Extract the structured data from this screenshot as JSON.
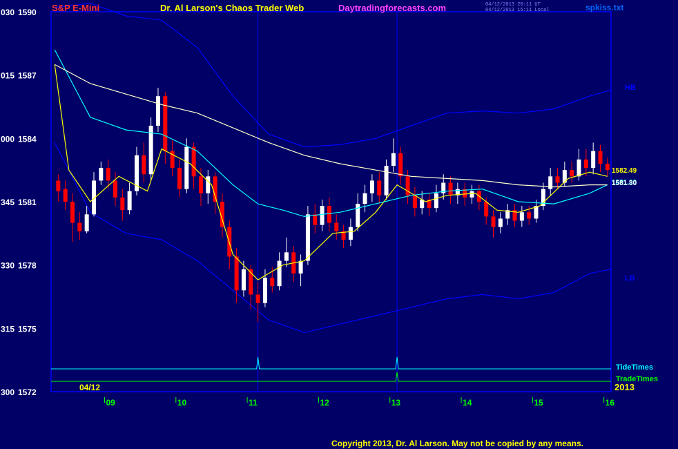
{
  "header": {
    "instrument": "S&P E-Mini",
    "title": "Dr. Al Larson's Chaos Trader Web",
    "site": "Daytradingforecasts.com",
    "stamp_utc": "04/12/2013 20:11 UT",
    "stamp_local": "04/12/2013 15:11 Local",
    "file": "spkiss.txt"
  },
  "footer": {
    "copyright": "Copyright 2013, Dr. Al Larson. May not be copied by any means."
  },
  "colors": {
    "background": "#000066",
    "frame": "#0000ff",
    "up_candle": "#ffffff",
    "down_candle": "#ff0000",
    "ema_fast": "#ffff00",
    "ema_mid": "#00ffff",
    "ema_slow": "#ffffcc",
    "bands": "#0000ff",
    "tide_times": "#00ffff",
    "trade_times": "#00ff00"
  },
  "chart_data": {
    "type": "line",
    "title": "S&P E-Mini",
    "y_left_labels": [
      {
        "code": "030",
        "price": "1590"
      },
      {
        "code": "015",
        "price": "1587"
      },
      {
        "code": "000",
        "price": "1584"
      },
      {
        "code": "345",
        "price": "1581"
      },
      {
        "code": "330",
        "price": "1578"
      },
      {
        "code": "315",
        "price": "1575"
      },
      {
        "code": "300",
        "price": "1572"
      }
    ],
    "ylim": [
      1572,
      1590
    ],
    "x_hour_labels": [
      "09",
      "10",
      "11",
      "12",
      "13",
      "14",
      "15",
      "16"
    ],
    "date_label": "04/12",
    "year_label": "2013",
    "band_labels": {
      "upper": "HB",
      "lower": "LB"
    },
    "price_tags": {
      "fast": "1582.49",
      "mid": "1581.90",
      "slow": "1581.80"
    },
    "timing_rows": [
      {
        "name": "TideTimes",
        "spikes_at_hour": [
          11.15,
          13.1
        ]
      },
      {
        "name": "TradeTimes",
        "spikes_at_hour": [
          13.1
        ]
      }
    ],
    "vertical_time_lines": [
      11.15,
      13.1
    ],
    "series": [
      {
        "name": "ema_fast",
        "x": [
          8.3,
          8.5,
          8.8,
          9.2,
          9.6,
          9.8,
          10.2,
          10.5,
          10.8,
          11.15,
          11.5,
          11.8,
          12.2,
          12.5,
          12.8,
          13.1,
          13.5,
          13.8,
          14.2,
          14.5,
          14.8,
          15.1,
          15.5,
          15.8,
          16.05
        ],
        "y": [
          1587.5,
          1582.5,
          1581.0,
          1582.2,
          1581.5,
          1583.5,
          1582.8,
          1581.8,
          1578.5,
          1577.3,
          1578.0,
          1578.2,
          1579.5,
          1579.6,
          1580.5,
          1581.8,
          1581.0,
          1581.3,
          1581.4,
          1580.6,
          1580.5,
          1580.8,
          1582.1,
          1582.4,
          1582.2
        ]
      },
      {
        "name": "ema_mid",
        "x": [
          8.3,
          8.8,
          9.3,
          9.8,
          10.3,
          10.8,
          11.15,
          11.5,
          11.8,
          12.3,
          12.8,
          13.3,
          13.8,
          14.3,
          14.8,
          15.3,
          15.8,
          16.05
        ],
        "y": [
          1588.2,
          1585.0,
          1584.4,
          1584.2,
          1583.4,
          1581.8,
          1580.9,
          1580.6,
          1580.3,
          1580.5,
          1580.9,
          1581.3,
          1581.5,
          1581.6,
          1581.0,
          1580.9,
          1581.4,
          1581.8
        ]
      },
      {
        "name": "ema_slow",
        "x": [
          8.3,
          8.8,
          9.3,
          9.8,
          10.3,
          10.8,
          11.3,
          11.8,
          12.3,
          12.8,
          13.3,
          13.8,
          14.3,
          14.8,
          15.3,
          15.8,
          16.05
        ],
        "y": [
          1587.5,
          1586.6,
          1586.1,
          1585.6,
          1585.2,
          1584.5,
          1583.8,
          1583.2,
          1582.8,
          1582.5,
          1582.2,
          1582.1,
          1582.0,
          1581.8,
          1581.7,
          1581.8,
          1581.8
        ]
      },
      {
        "name": "upper_band",
        "x": [
          8.3,
          8.8,
          9.3,
          9.8,
          10.3,
          10.8,
          11.3,
          11.8,
          12.3,
          12.8,
          13.3,
          13.8,
          14.3,
          14.8,
          15.3,
          15.8,
          16.1
        ],
        "y": [
          1590.2,
          1590.4,
          1589.8,
          1589.6,
          1588.3,
          1586.0,
          1584.2,
          1583.6,
          1583.7,
          1584.0,
          1584.6,
          1585.2,
          1585.3,
          1585.2,
          1585.4,
          1586.0,
          1586.3
        ]
      },
      {
        "name": "lower_band",
        "x": [
          8.3,
          8.8,
          9.3,
          9.8,
          10.3,
          10.8,
          11.3,
          11.8,
          12.3,
          12.8,
          13.3,
          13.8,
          14.3,
          14.8,
          15.3,
          15.8,
          16.1
        ],
        "y": [
          1583.8,
          1580.5,
          1579.5,
          1579.2,
          1578.2,
          1576.8,
          1575.4,
          1574.8,
          1575.2,
          1575.6,
          1576.0,
          1576.4,
          1576.6,
          1576.4,
          1576.7,
          1577.6,
          1577.8
        ]
      }
    ],
    "candles": [
      {
        "x": 8.35,
        "o": 1582.0,
        "c": 1581.5,
        "h": 1582.3,
        "l": 1581.0
      },
      {
        "x": 8.45,
        "o": 1581.6,
        "c": 1581.0,
        "h": 1582.0,
        "l": 1580.6
      },
      {
        "x": 8.55,
        "o": 1581.0,
        "c": 1580.0,
        "h": 1581.4,
        "l": 1579.1
      },
      {
        "x": 8.65,
        "o": 1580.0,
        "c": 1579.6,
        "h": 1580.5,
        "l": 1579.2
      },
      {
        "x": 8.75,
        "o": 1579.6,
        "c": 1580.4,
        "h": 1580.8,
        "l": 1579.5
      },
      {
        "x": 8.85,
        "o": 1580.4,
        "c": 1582.0,
        "h": 1582.4,
        "l": 1580.3
      },
      {
        "x": 8.95,
        "o": 1582.0,
        "c": 1582.6,
        "h": 1582.9,
        "l": 1581.8
      },
      {
        "x": 9.05,
        "o": 1582.6,
        "c": 1582.0,
        "h": 1583.0,
        "l": 1581.6
      },
      {
        "x": 9.15,
        "o": 1582.0,
        "c": 1581.2,
        "h": 1582.4,
        "l": 1580.8
      },
      {
        "x": 9.25,
        "o": 1581.2,
        "c": 1580.6,
        "h": 1581.6,
        "l": 1580.1
      },
      {
        "x": 9.35,
        "o": 1580.6,
        "c": 1581.5,
        "h": 1581.9,
        "l": 1580.4
      },
      {
        "x": 9.45,
        "o": 1581.5,
        "c": 1583.2,
        "h": 1583.6,
        "l": 1581.3
      },
      {
        "x": 9.55,
        "o": 1583.2,
        "c": 1582.3,
        "h": 1583.8,
        "l": 1581.9
      },
      {
        "x": 9.65,
        "o": 1582.3,
        "c": 1584.6,
        "h": 1585.0,
        "l": 1582.0
      },
      {
        "x": 9.75,
        "o": 1584.6,
        "c": 1586.0,
        "h": 1586.4,
        "l": 1584.3
      },
      {
        "x": 9.85,
        "o": 1586.0,
        "c": 1583.4,
        "h": 1586.2,
        "l": 1582.8
      },
      {
        "x": 9.95,
        "o": 1583.4,
        "c": 1582.6,
        "h": 1583.9,
        "l": 1582.2
      },
      {
        "x": 10.05,
        "o": 1582.6,
        "c": 1581.6,
        "h": 1583.0,
        "l": 1581.2
      },
      {
        "x": 10.15,
        "o": 1581.6,
        "c": 1583.6,
        "h": 1584.0,
        "l": 1581.4
      },
      {
        "x": 10.25,
        "o": 1583.6,
        "c": 1582.2,
        "h": 1583.8,
        "l": 1581.6
      },
      {
        "x": 10.35,
        "o": 1582.2,
        "c": 1581.4,
        "h": 1582.6,
        "l": 1580.8
      },
      {
        "x": 10.45,
        "o": 1581.4,
        "c": 1582.2,
        "h": 1582.5,
        "l": 1580.9
      },
      {
        "x": 10.55,
        "o": 1582.2,
        "c": 1581.0,
        "h": 1582.4,
        "l": 1580.4
      },
      {
        "x": 10.65,
        "o": 1581.0,
        "c": 1579.8,
        "h": 1581.4,
        "l": 1579.3
      },
      {
        "x": 10.75,
        "o": 1579.8,
        "c": 1578.4,
        "h": 1580.1,
        "l": 1577.8
      },
      {
        "x": 10.85,
        "o": 1578.4,
        "c": 1576.8,
        "h": 1578.8,
        "l": 1576.2
      },
      {
        "x": 10.95,
        "o": 1576.8,
        "c": 1577.8,
        "h": 1578.2,
        "l": 1576.5
      },
      {
        "x": 11.05,
        "o": 1577.8,
        "c": 1576.6,
        "h": 1578.0,
        "l": 1575.9
      },
      {
        "x": 11.15,
        "o": 1576.6,
        "c": 1576.2,
        "h": 1577.2,
        "l": 1575.3
      },
      {
        "x": 11.25,
        "o": 1576.2,
        "c": 1577.4,
        "h": 1577.8,
        "l": 1576.0
      },
      {
        "x": 11.35,
        "o": 1577.4,
        "c": 1577.0,
        "h": 1577.9,
        "l": 1576.7
      },
      {
        "x": 11.45,
        "o": 1577.0,
        "c": 1578.2,
        "h": 1578.6,
        "l": 1576.8
      },
      {
        "x": 11.55,
        "o": 1578.2,
        "c": 1578.6,
        "h": 1579.3,
        "l": 1577.9
      },
      {
        "x": 11.65,
        "o": 1578.6,
        "c": 1577.6,
        "h": 1578.9,
        "l": 1577.2
      },
      {
        "x": 11.75,
        "o": 1577.6,
        "c": 1578.2,
        "h": 1578.5,
        "l": 1577.0
      },
      {
        "x": 11.85,
        "o": 1578.2,
        "c": 1580.4,
        "h": 1580.8,
        "l": 1578.0
      },
      {
        "x": 11.95,
        "o": 1580.4,
        "c": 1579.9,
        "h": 1580.9,
        "l": 1579.5
      },
      {
        "x": 12.05,
        "o": 1579.9,
        "c": 1580.8,
        "h": 1581.1,
        "l": 1579.6
      },
      {
        "x": 12.15,
        "o": 1580.8,
        "c": 1580.0,
        "h": 1581.2,
        "l": 1579.6
      },
      {
        "x": 12.25,
        "o": 1580.0,
        "c": 1579.6,
        "h": 1580.4,
        "l": 1579.2
      },
      {
        "x": 12.35,
        "o": 1579.6,
        "c": 1579.2,
        "h": 1579.9,
        "l": 1578.8
      },
      {
        "x": 12.45,
        "o": 1579.2,
        "c": 1579.8,
        "h": 1580.2,
        "l": 1578.9
      },
      {
        "x": 12.55,
        "o": 1579.8,
        "c": 1580.9,
        "h": 1581.4,
        "l": 1579.6
      },
      {
        "x": 12.65,
        "o": 1580.9,
        "c": 1581.4,
        "h": 1581.8,
        "l": 1580.5
      },
      {
        "x": 12.75,
        "o": 1581.4,
        "c": 1582.0,
        "h": 1582.3,
        "l": 1581.0
      },
      {
        "x": 12.85,
        "o": 1582.0,
        "c": 1581.3,
        "h": 1582.4,
        "l": 1580.9
      },
      {
        "x": 12.95,
        "o": 1581.3,
        "c": 1582.7,
        "h": 1583.0,
        "l": 1581.1
      },
      {
        "x": 13.05,
        "o": 1582.7,
        "c": 1583.3,
        "h": 1584.0,
        "l": 1582.4
      },
      {
        "x": 13.15,
        "o": 1583.3,
        "c": 1582.2,
        "h": 1583.6,
        "l": 1581.8
      },
      {
        "x": 13.25,
        "o": 1582.2,
        "c": 1581.3,
        "h": 1582.5,
        "l": 1580.9
      },
      {
        "x": 13.35,
        "o": 1581.3,
        "c": 1580.7,
        "h": 1581.7,
        "l": 1580.3
      },
      {
        "x": 13.45,
        "o": 1580.7,
        "c": 1581.1,
        "h": 1581.5,
        "l": 1580.4
      },
      {
        "x": 13.55,
        "o": 1581.1,
        "c": 1580.7,
        "h": 1581.4,
        "l": 1580.3
      },
      {
        "x": 13.65,
        "o": 1580.7,
        "c": 1581.4,
        "h": 1581.8,
        "l": 1580.5
      },
      {
        "x": 13.75,
        "o": 1581.4,
        "c": 1581.9,
        "h": 1582.3,
        "l": 1581.1
      },
      {
        "x": 13.85,
        "o": 1581.9,
        "c": 1581.3,
        "h": 1582.2,
        "l": 1580.9
      },
      {
        "x": 13.95,
        "o": 1581.3,
        "c": 1581.6,
        "h": 1581.9,
        "l": 1580.9
      },
      {
        "x": 14.05,
        "o": 1581.6,
        "c": 1581.2,
        "h": 1581.9,
        "l": 1580.8
      },
      {
        "x": 14.15,
        "o": 1581.2,
        "c": 1581.5,
        "h": 1581.8,
        "l": 1580.9
      },
      {
        "x": 14.25,
        "o": 1581.5,
        "c": 1581.0,
        "h": 1581.8,
        "l": 1580.6
      },
      {
        "x": 14.35,
        "o": 1581.0,
        "c": 1580.3,
        "h": 1581.2,
        "l": 1579.9
      },
      {
        "x": 14.45,
        "o": 1580.3,
        "c": 1579.8,
        "h": 1580.6,
        "l": 1579.3
      },
      {
        "x": 14.55,
        "o": 1579.8,
        "c": 1580.2,
        "h": 1580.5,
        "l": 1579.5
      },
      {
        "x": 14.65,
        "o": 1580.2,
        "c": 1580.6,
        "h": 1580.9,
        "l": 1579.9
      },
      {
        "x": 14.75,
        "o": 1580.6,
        "c": 1580.1,
        "h": 1580.9,
        "l": 1579.8
      },
      {
        "x": 14.85,
        "o": 1580.1,
        "c": 1580.5,
        "h": 1580.8,
        "l": 1579.8
      },
      {
        "x": 14.95,
        "o": 1580.5,
        "c": 1580.2,
        "h": 1580.8,
        "l": 1579.9
      },
      {
        "x": 15.05,
        "o": 1580.2,
        "c": 1580.8,
        "h": 1581.1,
        "l": 1580.0
      },
      {
        "x": 15.15,
        "o": 1580.8,
        "c": 1581.6,
        "h": 1581.9,
        "l": 1580.6
      },
      {
        "x": 15.25,
        "o": 1581.6,
        "c": 1582.2,
        "h": 1582.6,
        "l": 1581.3
      },
      {
        "x": 15.35,
        "o": 1582.2,
        "c": 1581.9,
        "h": 1582.6,
        "l": 1581.6
      },
      {
        "x": 15.45,
        "o": 1581.9,
        "c": 1582.5,
        "h": 1582.9,
        "l": 1581.7
      },
      {
        "x": 15.55,
        "o": 1582.5,
        "c": 1582.2,
        "h": 1582.9,
        "l": 1581.9
      },
      {
        "x": 15.65,
        "o": 1582.2,
        "c": 1583.0,
        "h": 1583.5,
        "l": 1582.0
      },
      {
        "x": 15.75,
        "o": 1583.0,
        "c": 1582.6,
        "h": 1583.5,
        "l": 1582.2
      },
      {
        "x": 15.85,
        "o": 1582.6,
        "c": 1583.4,
        "h": 1583.8,
        "l": 1582.3
      },
      {
        "x": 15.95,
        "o": 1583.4,
        "c": 1582.8,
        "h": 1583.7,
        "l": 1582.4
      },
      {
        "x": 16.05,
        "o": 1582.8,
        "c": 1582.5,
        "h": 1583.1,
        "l": 1582.2
      }
    ]
  }
}
